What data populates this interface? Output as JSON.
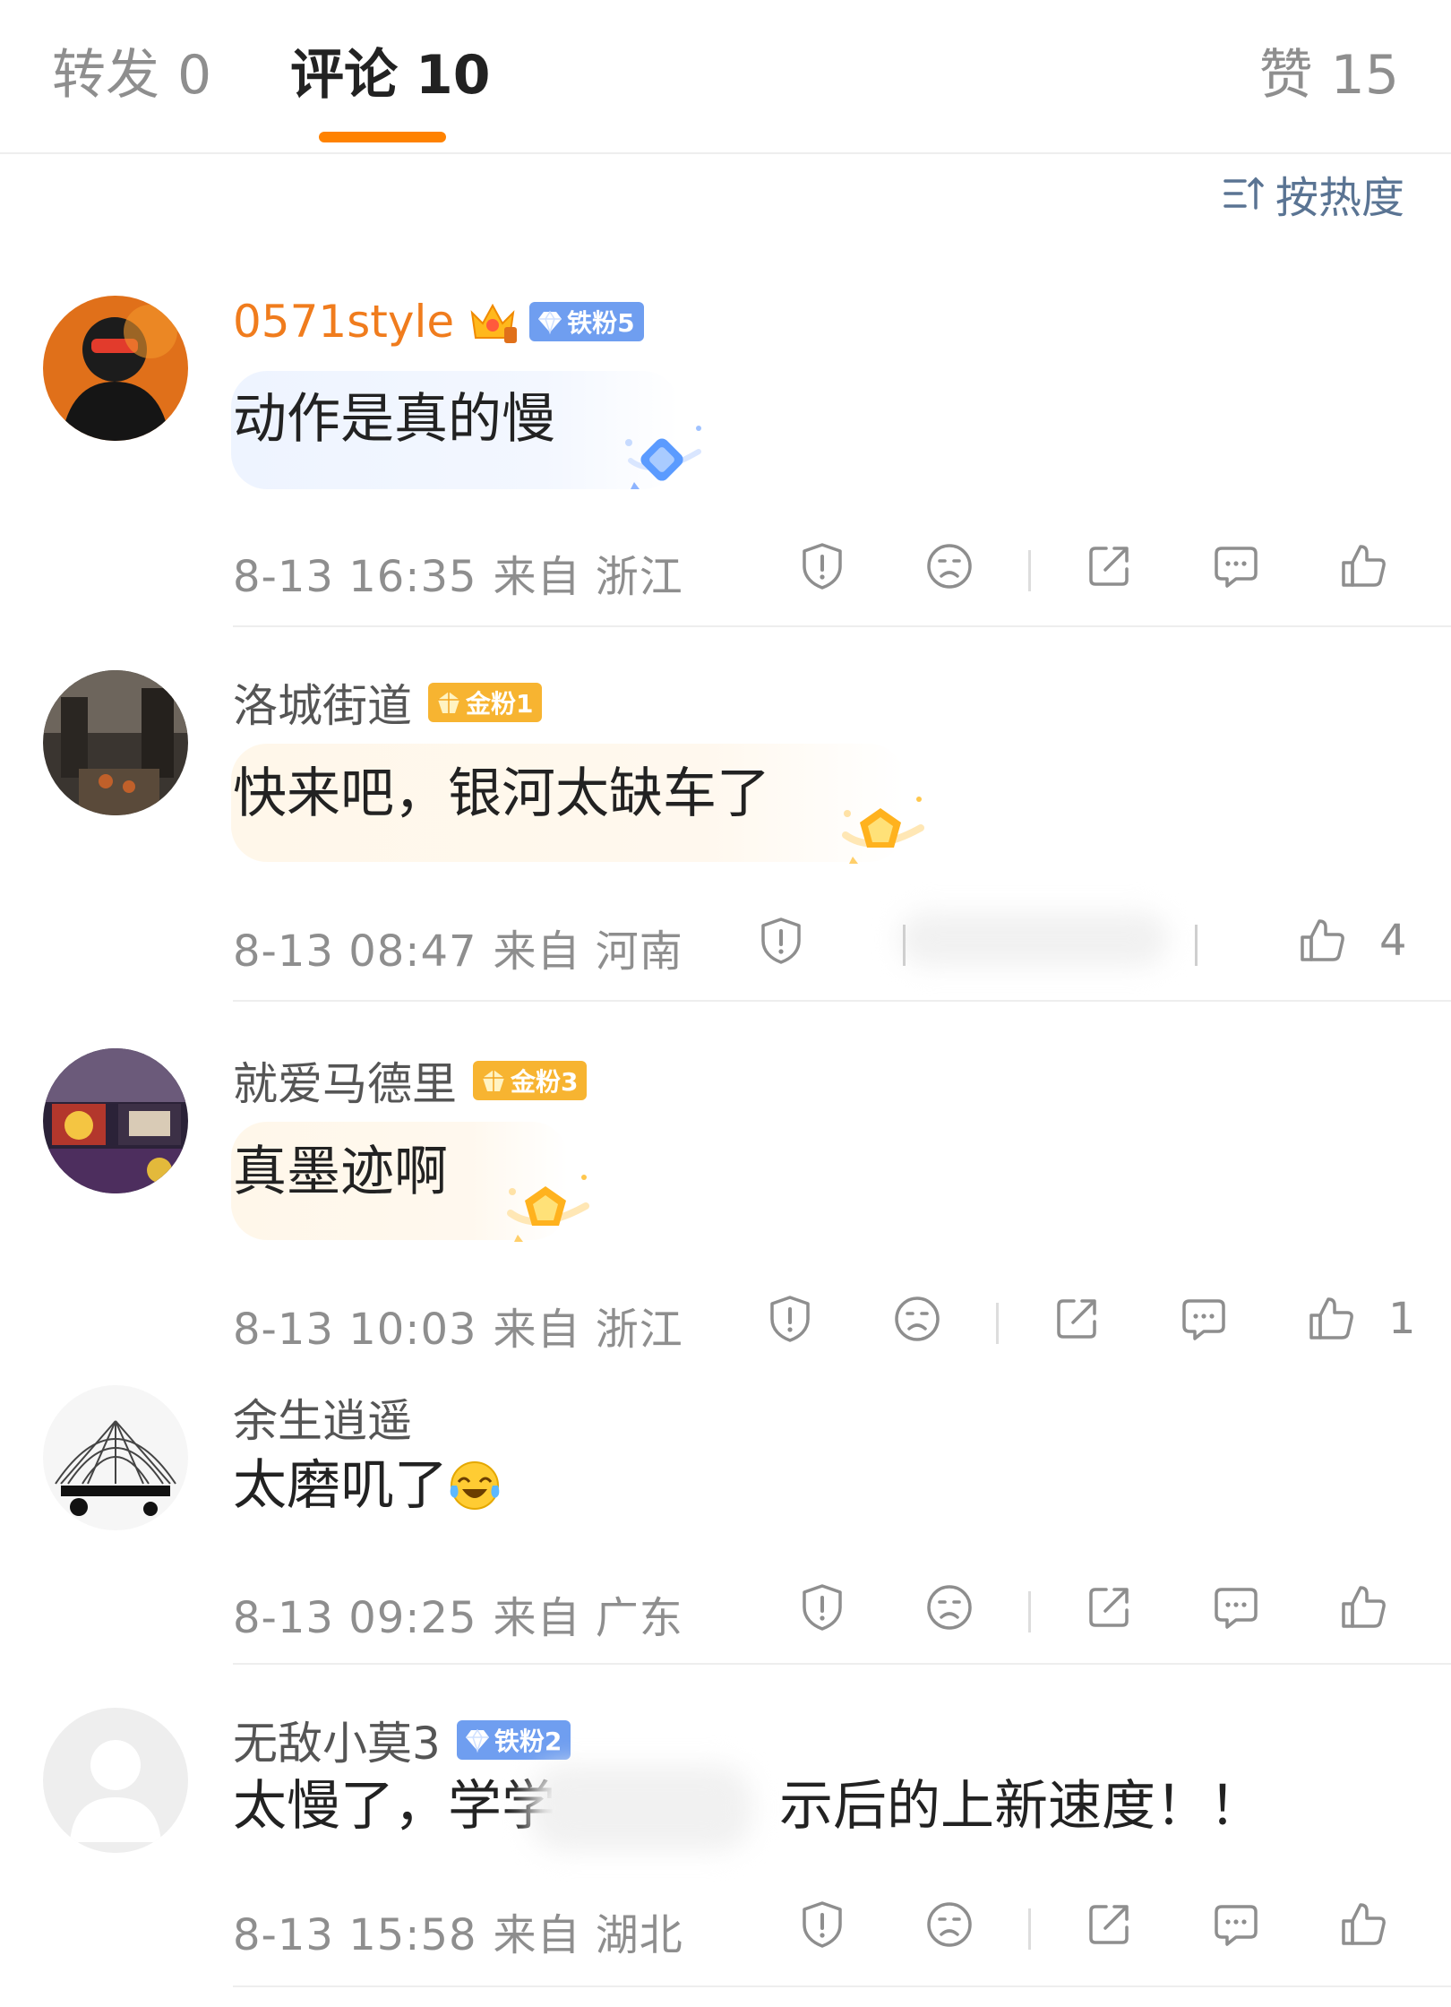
{
  "tabs": [
    {
      "label": "转发",
      "count": "0"
    },
    {
      "label": "评论",
      "count": "10"
    },
    {
      "label": "赞",
      "count": "15"
    }
  ],
  "sort": {
    "label": "按热度",
    "icon": "sort-icon"
  },
  "colors": {
    "accent": "#ff8200",
    "vip_name": "#f07c1d",
    "iron_badge": "#6f9ef0",
    "gold_badge": "#f7b431",
    "meta_text": "#8e8e8e",
    "sort_text": "#5a7493"
  },
  "comments": [
    {
      "username": "0571style",
      "badge": "铁粉5",
      "text": "动作是真的慢",
      "time": "8-13 16:35",
      "location": "来自 浙江",
      "likes": ""
    },
    {
      "username": "洛城街道",
      "badge": "金粉1",
      "text": "快来吧，银河太缺车了",
      "time": "8-13 08:47",
      "location": "来自 河南",
      "likes": "4"
    },
    {
      "username": "就爱马德里",
      "badge": "金粉3",
      "text": "真墨迹啊",
      "time": "8-13 10:03",
      "location": "来自 浙江",
      "likes": "1"
    },
    {
      "username": "余生逍遥",
      "badge": "",
      "text": "太磨叽了",
      "time": "8-13 09:25",
      "location": "来自 广东",
      "likes": ""
    },
    {
      "username": "无敌小莫3",
      "badge": "铁粉2",
      "text": "太慢了，学学",
      "text_after": "示后的上新速度！！",
      "time": "8-13 15:58",
      "location": "来自 湖北",
      "likes": ""
    }
  ],
  "action_icons": [
    "report-icon",
    "dislike-icon",
    "share-icon",
    "reply-icon",
    "like-icon"
  ]
}
